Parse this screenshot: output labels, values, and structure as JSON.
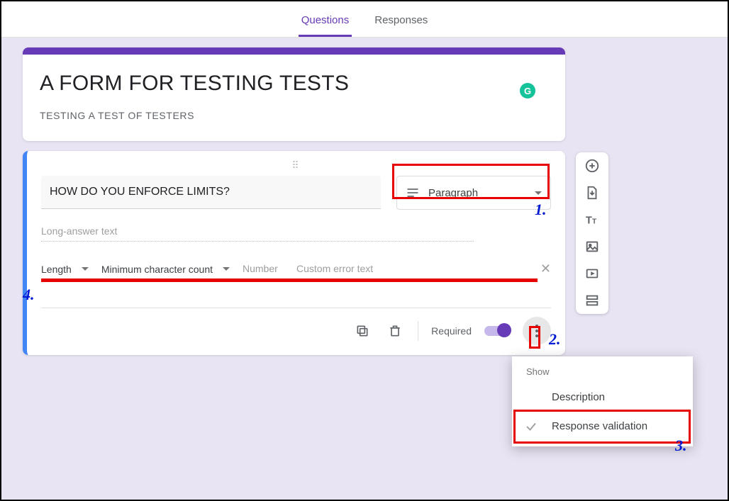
{
  "tabs": {
    "questions": "Questions",
    "responses": "Responses"
  },
  "form": {
    "title": "A FORM FOR TESTING TESTS",
    "description": "TESTING A TEST OF TESTERS",
    "grammarly_badge": "G"
  },
  "question": {
    "text": "HOW DO YOU ENFORCE LIMITS?",
    "type_label": "Paragraph",
    "long_answer_placeholder": "Long-answer text"
  },
  "validation": {
    "kind": "Length",
    "rule": "Minimum character count",
    "number_placeholder": "Number",
    "error_placeholder": "Custom error text"
  },
  "footer": {
    "required_label": "Required",
    "required_on": true
  },
  "popup": {
    "heading": "Show",
    "item_description": "Description",
    "item_response_validation": "Response validation"
  },
  "annotations": {
    "n1": "1.",
    "n2": "2.",
    "n3": "3.",
    "n4": "4."
  }
}
